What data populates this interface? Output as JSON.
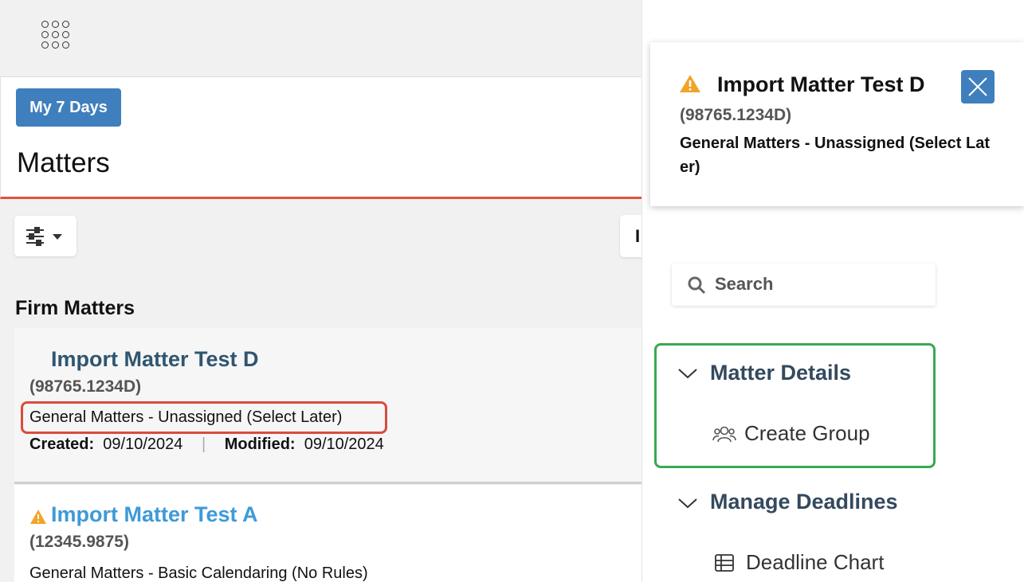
{
  "header": {
    "my7days_label": "My 7 Days",
    "title": "Matters"
  },
  "left": {
    "side_stub_text": "I",
    "section_title": "Firm Matters",
    "matters": [
      {
        "name": "Import Matter Test D",
        "number": "(98765.1234D)",
        "category": "General Matters - Unassigned (Select Later)",
        "created_label": "Created:",
        "created": "09/10/2024",
        "modified_label": "Modified:",
        "modified": "09/10/2024",
        "warning": false
      },
      {
        "name": "Import Matter Test A",
        "number": "(12345.9875)",
        "category": "General Matters - Basic Calendaring (No Rules)",
        "warning": true
      }
    ]
  },
  "right": {
    "notification": {
      "title": "Import Matter Test D",
      "number": "(98765.1234D)",
      "category": "General Matters - Unassigned (Select Later)"
    },
    "search": {
      "placeholder": "Search"
    },
    "groups": [
      {
        "label": "Matter Details",
        "items": [
          {
            "label": "Create Group",
            "icon": "users-icon"
          }
        ]
      },
      {
        "label": "Manage Deadlines",
        "items": [
          {
            "label": "Deadline Chart",
            "icon": "table-icon"
          }
        ]
      }
    ]
  },
  "colors": {
    "primary": "#3f7fbd",
    "warning": "#f0a428",
    "highlight_red": "#d84c3d",
    "highlight_green": "#3aa852",
    "header_underline": "#e0523f",
    "link_blue": "#3e9ad8",
    "title_dark": "#2f5670"
  }
}
